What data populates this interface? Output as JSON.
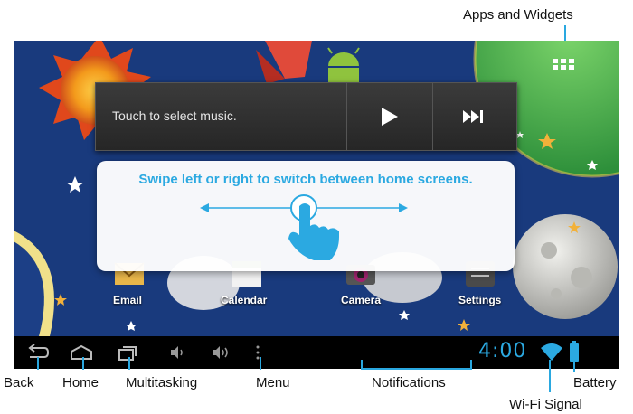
{
  "callouts": {
    "apps_widgets": "Apps and Widgets",
    "back": "Back",
    "home": "Home",
    "multitasking": "Multitasking",
    "menu": "Menu",
    "notifications": "Notifications",
    "battery": "Battery",
    "wifi": "Wi-Fi Signal"
  },
  "music_widget": {
    "prompt": "Touch to select music."
  },
  "hint": {
    "text": "Swipe left or right to switch between home screens."
  },
  "apps": [
    {
      "label": "Email",
      "icon": "email-icon"
    },
    {
      "label": "Calendar",
      "icon": "calendar-icon"
    },
    {
      "label": "Camera",
      "icon": "camera-icon"
    },
    {
      "label": "Settings",
      "icon": "settings-icon"
    }
  ],
  "status": {
    "time": "4:00"
  },
  "colors": {
    "accent": "#2ba9e1",
    "wallpaper": "#1c3f86",
    "navbar": "#000000"
  }
}
